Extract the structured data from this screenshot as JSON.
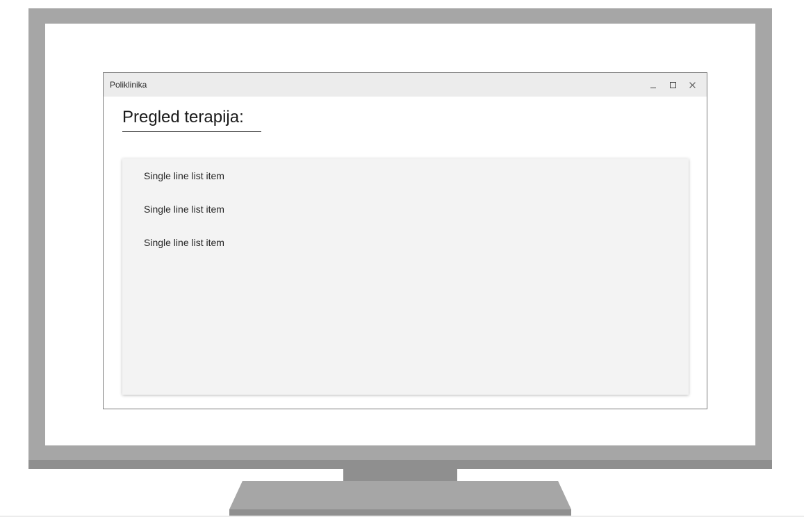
{
  "window": {
    "title": "Poliklinika"
  },
  "window_controls": {
    "minimize_icon": "minimize-icon",
    "maximize_icon": "maximize-icon",
    "close_icon": "close-icon"
  },
  "main": {
    "heading": "Pregled terapija:",
    "list": {
      "items": [
        "Single line list item",
        "Single line list item",
        "Single line list item"
      ]
    }
  },
  "colors": {
    "monitor_frame": "#a6a6a6",
    "monitor_shadow": "#8f8f8f",
    "title_bar": "#ececec",
    "list_background": "#f3f3f3"
  }
}
